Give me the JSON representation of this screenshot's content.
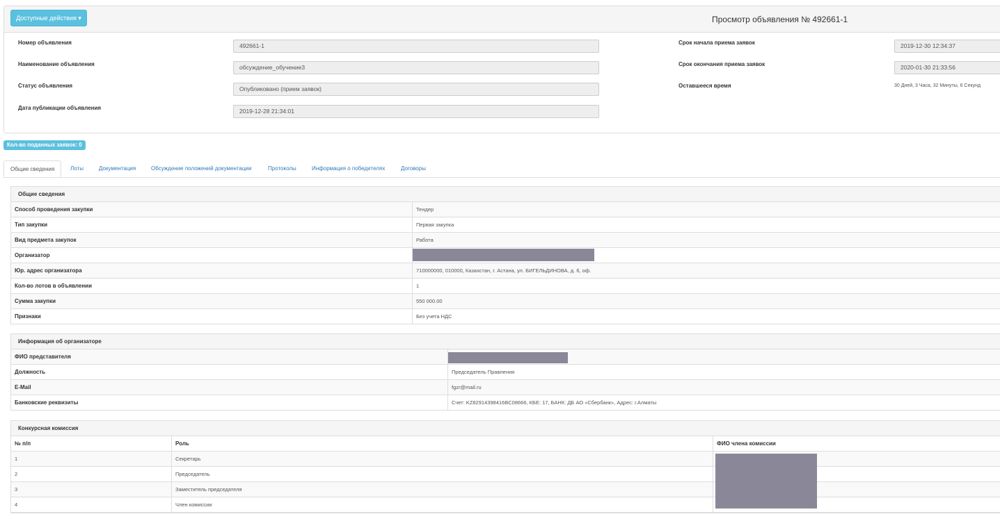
{
  "header": {
    "actions_label": "Доступные действия ▾",
    "title": "Просмотр объявления № 492661-1"
  },
  "fields_left": [
    {
      "label": "Номер объявления",
      "value": "492661-1"
    },
    {
      "label": "Наименование объявления",
      "value": "обсуждение_обучение3"
    },
    {
      "label": "Статус объявления",
      "value": "Опубликовано (прием заявок)"
    },
    {
      "label": "Дата публикации объявления",
      "value": "2019-12-28 21:34:01"
    }
  ],
  "fields_right": [
    {
      "label": "Срок начала приема заявок",
      "value": "2019-12-30 12:34:37"
    },
    {
      "label": "Срок окончания приема заявок",
      "value": "2020-01-30 21:33:56"
    },
    {
      "label": "Оставшееся время",
      "value": "30 Дней, 3 Часа, 32 Минуты, 6 Секунд"
    }
  ],
  "badge": "Кол-во поданных заявок: 0",
  "tabs": [
    "Общие сведения",
    "Лоты",
    "Документация",
    "Обсуждение положений документации",
    "Протоколы",
    "Информация о победителях",
    "Договоры"
  ],
  "general": {
    "title": "Общие сведения",
    "rows": [
      {
        "label": "Способ проведения закупки",
        "value": "Тендер"
      },
      {
        "label": "Тип закупки",
        "value": "Первая закупка"
      },
      {
        "label": "Вид предмета закупок",
        "value": "Работа"
      },
      {
        "label": "Организатор",
        "value": ""
      },
      {
        "label": "Юр. адрес организатора",
        "value": "710000000, 010000, Казахстан, г. Астана, ул. БИГЕЛЬДИНОВА, д. 6, оф."
      },
      {
        "label": "Кол-во лотов в объявлении",
        "value": "1"
      },
      {
        "label": "Сумма закупки",
        "value": "550 000.00"
      },
      {
        "label": "Признаки",
        "value": "Без учета НДС"
      }
    ]
  },
  "organizer": {
    "title": "Информация об организаторе",
    "rows": [
      {
        "label": "ФИО представителя",
        "value": ""
      },
      {
        "label": "Должность",
        "value": "Председатель Правления"
      },
      {
        "label": "E-Mail",
        "value": "fgzr@mail.ru"
      },
      {
        "label": "Банковские реквизиты",
        "value": "Счет: KZ82914398416BC08666, КБЕ: 17, БАНК: ДБ АО «Сбербанк», Адрес: г.Алматы"
      }
    ]
  },
  "commission": {
    "title": "Конкурсная комиссия",
    "headers": [
      "№ п/п",
      "Роль",
      "ФИО члена комиссии"
    ],
    "rows": [
      {
        "n": "1",
        "role": "Секретарь"
      },
      {
        "n": "2",
        "role": "Председатель"
      },
      {
        "n": "3",
        "role": "Заместитель председателя"
      },
      {
        "n": "4",
        "role": "Член комиссии"
      }
    ]
  }
}
